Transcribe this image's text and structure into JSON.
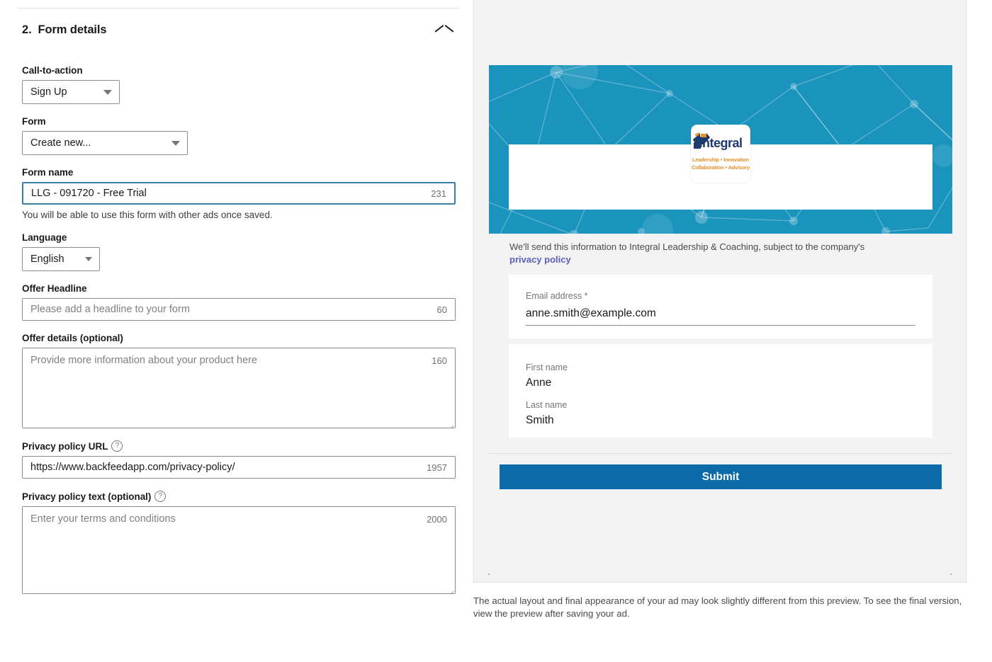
{
  "section": {
    "number": "2.",
    "title": "Form details",
    "collapse_icon": "chevron-up-icon"
  },
  "fields": {
    "cta": {
      "label": "Call-to-action",
      "value": "Sign Up"
    },
    "form": {
      "label": "Form",
      "value": "Create new..."
    },
    "form_name": {
      "label": "Form name",
      "value": "LLG - 091720 - Free Trial",
      "counter": "231",
      "helper": "You will be able to use this form with other ads once saved."
    },
    "language": {
      "label": "Language",
      "value": "English"
    },
    "offer_headline": {
      "label": "Offer Headline",
      "placeholder": "Please add a headline to your form",
      "counter": "60"
    },
    "offer_details": {
      "label": "Offer details (optional)",
      "placeholder": "Provide more information about your product here",
      "counter": "160"
    },
    "privacy_url": {
      "label": "Privacy policy URL",
      "help_icon": "question-mark-circle-icon",
      "value": "https://www.backfeedapp.com/privacy-policy/",
      "counter": "1957"
    },
    "privacy_text": {
      "label": "Privacy policy text (optional)",
      "help_icon": "question-mark-circle-icon",
      "placeholder": "Enter your terms and conditions",
      "counter": "2000"
    }
  },
  "preview": {
    "logo": {
      "word": "Integral",
      "tagline_line1": "Leadership • Innovation",
      "tagline_line2": "Collaboration • Advisory"
    },
    "consent": {
      "text_before": "We'll send this information to Integral Leadership & Coaching, subject to the company's ",
      "link_text": "privacy policy"
    },
    "form_fields": [
      {
        "label": "Email address *",
        "value": "anne.smith@example.com"
      },
      {
        "label": "First name",
        "value": "Anne"
      },
      {
        "label": "Last name",
        "value": "Smith"
      }
    ],
    "submit_label": "Submit",
    "disclaimer": "The actual layout and final appearance of your ad may look slightly different from this preview. To see the final version, view the preview after saving your ad."
  },
  "colors": {
    "banner_teal": "#1a93bd",
    "submit_blue": "#0a6ba8",
    "link_purple": "#5d5dbd",
    "focus_blue": "#3b7fa8",
    "logo_navy": "#1f3a6e",
    "logo_orange": "#e8902a"
  }
}
